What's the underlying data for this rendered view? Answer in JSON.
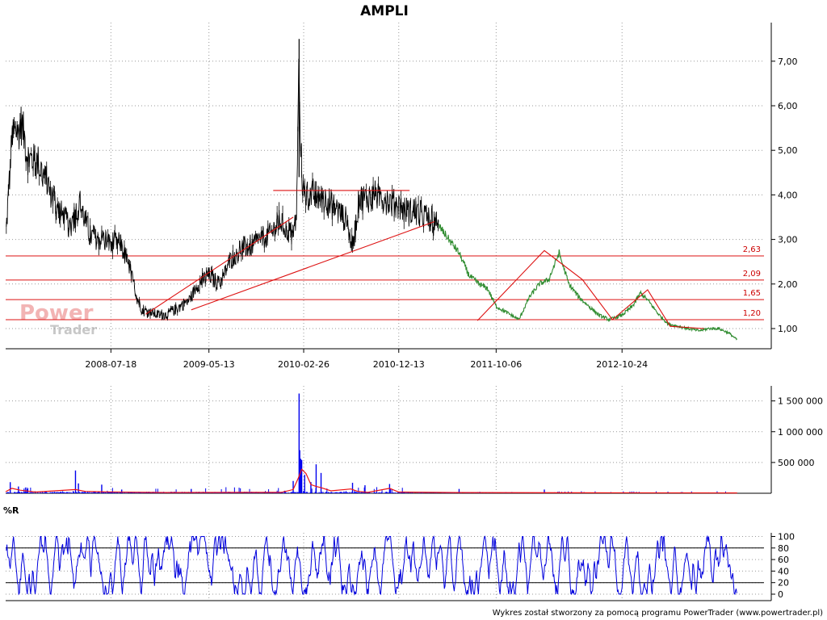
{
  "title": "AMPLI",
  "watermark": {
    "line1": "Power",
    "line2": "Trader"
  },
  "credit": "Wykres został stworzony za pomocą programu PowerTrader (www.powertrader.pl)",
  "colors": {
    "price": "#000000",
    "price_late": "#2e8b2e",
    "support": "#dd1111",
    "volume": "#0000ee",
    "volume_avg": "#ee1111",
    "williams": "#0000dd"
  },
  "chart_data": [
    {
      "type": "line",
      "panel": "price",
      "title": "AMPLI",
      "x_tick_labels": [
        "2008-07-18",
        "2009-05-13",
        "2010-02-26",
        "2010-12-13",
        "2011-10-06",
        "2012-10-24"
      ],
      "y_tick_labels": [
        "1,00",
        "2,00",
        "3,00",
        "4,00",
        "5,00",
        "6,00",
        "7,00"
      ],
      "ylim": [
        0.65,
        7.8
      ],
      "grid": true,
      "x_range": [
        "2007-09-01",
        "2013-12-31"
      ],
      "series": [
        {
          "type": "line",
          "x": [
            "2007-09-03",
            "2007-09-20",
            "2007-10-20",
            "2007-11-10",
            "2007-12-10",
            "2008-01-15",
            "2008-02-15",
            "2008-03-15",
            "2008-04-15",
            "2008-05-15",
            "2008-06-15",
            "2008-07-18",
            "2008-08-15",
            "2008-09-15",
            "2008-10-10",
            "2008-10-25",
            "2008-11-15",
            "2008-12-15",
            "2009-01-15",
            "2009-02-15",
            "2009-03-15",
            "2009-04-10",
            "2009-05-13",
            "2009-06-15",
            "2009-07-15",
            "2009-08-15",
            "2009-09-15",
            "2009-10-15",
            "2009-11-15",
            "2009-12-15",
            "2010-01-10",
            "2010-01-25",
            "2010-02-05",
            "2010-02-12",
            "2010-02-15",
            "2010-02-20",
            "2010-02-26",
            "2010-03-15",
            "2010-04-15",
            "2010-05-15",
            "2010-06-15",
            "2010-07-10",
            "2010-07-25",
            "2010-08-15",
            "2010-09-15",
            "2010-10-15",
            "2010-11-15",
            "2010-12-13",
            "2011-01-15",
            "2011-02-15",
            "2011-03-15",
            "2011-04-15",
            "2011-05-15",
            "2011-06-15",
            "2011-07-15",
            "2011-08-15",
            "2011-09-10",
            "2011-10-06",
            "2011-11-10",
            "2011-12-15",
            "2012-01-15",
            "2012-02-15",
            "2012-03-15",
            "2012-04-15",
            "2012-05-15",
            "2012-06-15",
            "2012-07-15",
            "2012-08-15",
            "2012-09-15",
            "2012-10-24",
            "2012-11-25",
            "2012-12-20",
            "2013-01-15",
            "2013-02-15",
            "2013-03-15",
            "2013-04-15",
            "2013-05-15",
            "2013-06-15",
            "2013-07-15",
            "2013-08-15",
            "2013-09-15",
            "2013-10-10"
          ],
          "y": [
            3.2,
            5.2,
            5.6,
            4.8,
            4.7,
            4.1,
            3.6,
            3.3,
            3.8,
            3.1,
            3.0,
            2.95,
            2.95,
            2.3,
            1.6,
            1.4,
            1.35,
            1.3,
            1.35,
            1.5,
            1.65,
            2.0,
            2.2,
            2.0,
            2.5,
            2.8,
            2.85,
            3.0,
            3.1,
            3.4,
            3.2,
            3.05,
            3.6,
            7.0,
            5.8,
            4.5,
            4.0,
            4.0,
            3.95,
            3.85,
            3.6,
            3.4,
            2.8,
            3.9,
            3.95,
            4.0,
            3.85,
            3.75,
            3.6,
            3.6,
            3.45,
            3.3,
            3.0,
            2.7,
            2.2,
            2.0,
            1.9,
            1.5,
            1.35,
            1.2,
            1.7,
            2.0,
            2.1,
            2.7,
            2.0,
            1.7,
            1.5,
            1.3,
            1.2,
            1.3,
            1.5,
            1.8,
            1.6,
            1.3,
            1.1,
            1.05,
            1.0,
            0.95,
            1.0,
            1.0,
            0.9,
            0.75
          ]
        }
      ],
      "support_levels": [
        {
          "value": 2.63,
          "label": "2,63"
        },
        {
          "value": 2.09,
          "label": "2,09"
        },
        {
          "value": 1.65,
          "label": "1,65"
        },
        {
          "value": 1.2,
          "label": "1,20"
        }
      ],
      "trend_lines": [
        {
          "x": [
            "2008-11-01",
            "2010-01-25"
          ],
          "y": [
            1.32,
            3.5
          ]
        },
        {
          "x": [
            "2009-03-20",
            "2011-04-01"
          ],
          "y": [
            1.42,
            3.4
          ]
        },
        {
          "x": [
            "2009-11-25",
            "2011-01-15"
          ],
          "y": [
            4.1,
            4.1
          ]
        },
        {
          "x": [
            "2011-08-10",
            "2012-03-01",
            "2012-06-25",
            "2012-09-25",
            "2013-01-10",
            "2013-03-20",
            "2013-07-01"
          ],
          "y": [
            1.18,
            2.75,
            2.1,
            1.2,
            1.87,
            1.05,
            1.0
          ]
        }
      ]
    },
    {
      "type": "bar",
      "panel": "volume",
      "y_tick_labels": [
        "500 000",
        "1 000 000",
        "1 500 000"
      ],
      "ylim": [
        0,
        1600000
      ],
      "grid": true,
      "spikes": [
        {
          "x": "2007-09-15",
          "y": 180000
        },
        {
          "x": "2007-10-10",
          "y": 110000
        },
        {
          "x": "2008-04-01",
          "y": 370000
        },
        {
          "x": "2008-04-10",
          "y": 160000
        },
        {
          "x": "2008-06-20",
          "y": 140000
        },
        {
          "x": "2008-08-20",
          "y": 60000
        },
        {
          "x": "2009-03-20",
          "y": 70000
        },
        {
          "x": "2010-01-25",
          "y": 200000
        },
        {
          "x": "2010-02-12",
          "y": 1620000
        },
        {
          "x": "2010-02-14",
          "y": 700000
        },
        {
          "x": "2010-02-17",
          "y": 560000
        },
        {
          "x": "2010-02-20",
          "y": 540000
        },
        {
          "x": "2010-03-01",
          "y": 300000
        },
        {
          "x": "2010-03-20",
          "y": 180000
        },
        {
          "x": "2010-04-05",
          "y": 470000
        },
        {
          "x": "2010-04-20",
          "y": 330000
        },
        {
          "x": "2010-07-25",
          "y": 170000
        },
        {
          "x": "2010-09-01",
          "y": 130000
        },
        {
          "x": "2010-11-15",
          "y": 150000
        },
        {
          "x": "2011-06-15",
          "y": 70000
        },
        {
          "x": "2012-03-01",
          "y": 60000
        }
      ],
      "moving_average": {
        "x": [
          "2007-09-01",
          "2007-09-20",
          "2007-10-15",
          "2007-12-01",
          "2008-04-01",
          "2008-05-01",
          "2008-07-01",
          "2009-01-01",
          "2009-12-20",
          "2010-01-25",
          "2010-02-10",
          "2010-02-20",
          "2010-03-05",
          "2010-03-20",
          "2010-04-05",
          "2010-04-20",
          "2010-05-20",
          "2010-07-20",
          "2010-08-10",
          "2010-09-10",
          "2010-11-15",
          "2010-12-13",
          "2011-06-01",
          "2012-06-01",
          "2013-10-10"
        ],
        "y": [
          25000,
          80000,
          50000,
          20000,
          60000,
          30000,
          22000,
          12000,
          15000,
          60000,
          250000,
          390000,
          320000,
          140000,
          110000,
          90000,
          40000,
          70000,
          30000,
          15000,
          80000,
          20000,
          12000,
          8000,
          5000
        ]
      }
    },
    {
      "type": "line",
      "panel": "oscillator",
      "title": "%R",
      "y_tick_labels": [
        "0",
        "20",
        "40",
        "60",
        "80",
        "100"
      ],
      "ylim": [
        0,
        100
      ],
      "reference_lines": [
        20,
        80
      ],
      "grid": true
    }
  ]
}
